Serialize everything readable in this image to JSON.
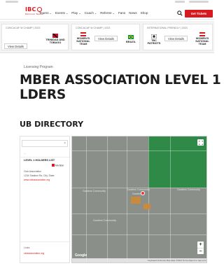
{
  "header": {
    "logo": "IBC",
    "logo_sub": "National Teams",
    "nav": [
      "Teams",
      "Events",
      "Play",
      "Coach",
      "Referee",
      "Fans",
      "News",
      "Shop"
    ],
    "cta": "Get Tickets"
  },
  "cards": [
    {
      "meta": "CONCACAF W CHAMP | 2023",
      "button": "View Details",
      "team_b": "TRINIDAD AND TOBAGO"
    },
    {
      "meta": "CONCACAF W CHAMP | 2023",
      "team_a": "WOMEN'S NATIONAL TEAM",
      "button": "View Details",
      "team_b": "BRAZIL"
    },
    {
      "meta": "INTERNATIONAL FRIENDLY | 2023",
      "team_a": "TBC",
      "team_a2": "PATRIOTS",
      "button": "View Details",
      "team_b": "WOMEN'S NATIONAL TEAM"
    }
  ],
  "breadcrumb": "Licensing Program",
  "title_line1": "MBER ASSOCIATION LEVEL 1",
  "title_line2": "LDERS",
  "subtitle": "UB DIRECTORY",
  "directory": {
    "label_top": "...",
    "item_name": "LEVEL 1 HOLDERS LIST",
    "item_tag": "Member",
    "item_line1": "Club Association",
    "item_line2": "1234 Stadium Rd, City, State",
    "item_link": "www.clubassociation.org",
    "item_bottom_label": "Links",
    "item_bottom_link": "clubassociation.org"
  },
  "map": {
    "labels": [
      "Gardens",
      "Gardens Community",
      "Gardens Community",
      "Gardens Community",
      "Gardens Community"
    ],
    "footer": "Keyboard shortcuts  Map data ©2024  Terms  Report a map error",
    "google": "Google"
  },
  "colors": {
    "brand_red": "#d71920",
    "park_green": "#2f8a47",
    "map_gray": "#8a8f8a",
    "block_orange": "#c98a3c",
    "pin_red": "#e53935"
  }
}
